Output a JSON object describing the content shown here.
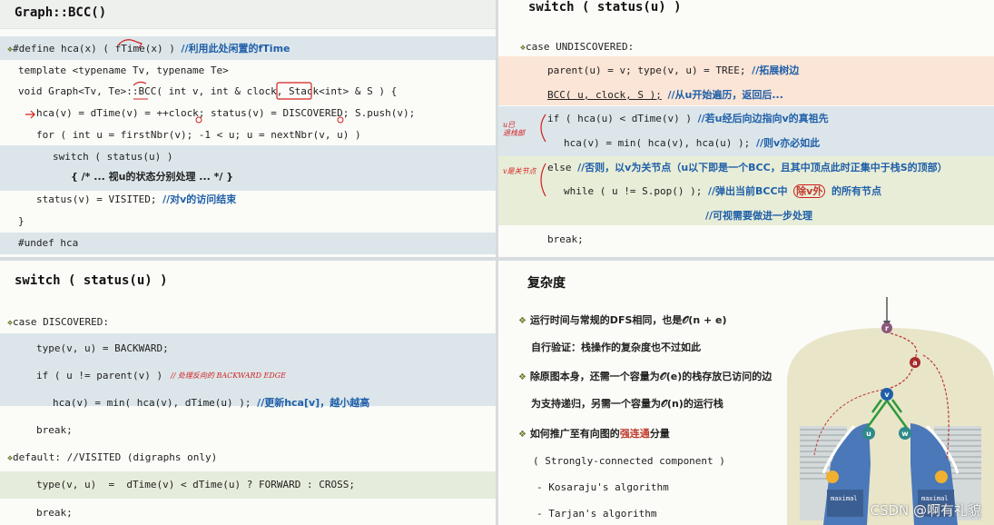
{
  "slide1": {
    "title": "Graph::BCC()",
    "lines": [
      "#define hca(x) ( fTime(x) )",
      "//利用此处闲置的fTime",
      "template <typename Tv, typename Te>",
      "void Graph<Tv, Te>::BCC( int v, int & clock, Stack<int> & S ) {",
      "hca(v) = dTime(v) = ++clock; status(v) = DISCOVERED; S.push(v);",
      "for ( int u = firstNbr(v); -1 < u; u = nextNbr(v, u) )",
      "switch ( status(u) )",
      "{ /* ... 视u的状态分别处理 ... */ }",
      "status(v) = VISITED;",
      "//对v的访问结束",
      "}",
      "#undef hca"
    ]
  },
  "slide2": {
    "title": "switch ( status(u) )",
    "case_label": "case UNDISCOVERED:",
    "lines": [
      "parent(u) = v; type(v, u) = TREE;",
      "//拓展树边",
      "BCC( u, clock, S );",
      "//从u开始遍历，返回后...",
      "if ( hca(u) < dTime(v) )",
      "//若u经后向边指向v的真祖先",
      "hca(v) = min( hca(v), hca(u) );",
      "//则v亦必如此",
      "else",
      "//否则，以v为关节点（u以下即是一个BCC，且其中顶点此时正集中于栈S的顶部）",
      "while ( u != S.pop() );",
      "//弹出当前BCC中",
      "除v外",
      "的所有节点",
      "//可视需要做进一步处理",
      "break;"
    ],
    "notes": [
      "u已\n退栈部",
      "v是关节点"
    ]
  },
  "slide3": {
    "title": "switch ( status(u) )",
    "case_discovered": "case DISCOVERED:",
    "lines": [
      "type(v, u) = BACKWARD;",
      "if ( u != parent(v) )",
      "hca(v) = min( hca(v), dTime(u) );",
      "//更新hca[v]，越小越高",
      "break;",
      "default: //VISITED (digraphs only)",
      "type(v, u)  =  dTime(v) < dTime(u) ? FORWARD : CROSS;",
      "break;"
    ],
    "handnote": "// 处理反向的 BACKWARD EDGE"
  },
  "slide4": {
    "title": "复杂度",
    "bullets": [
      "运行时间与常规的DFS相同，也是𝒪(n + e)",
      "自行验证：栈操作的复杂度也不过如此",
      "除原图本身，还需一个容量为𝒪(e)的栈存放已访问的边",
      "为支持递归，另需一个容量为𝒪(n)的运行栈",
      "如何推广至有向图的",
      "强连通",
      "分量",
      "( Strongly-connected component )",
      "- Kosaraju's algorithm",
      "- Tarjan's algorithm"
    ],
    "diagram_nodes": [
      "r",
      "a",
      "v",
      "u",
      "w"
    ],
    "diagram_labels": [
      "maximal",
      "maximal"
    ],
    "watermark": "CSDN @啊有礼貌"
  },
  "colors": {
    "band_blue": "#dce6ea",
    "band_orange": "#fbe5d6",
    "band_green": "#e8edd8",
    "accent_red": "#c0392b",
    "comment_blue": "#1f5fa9"
  }
}
